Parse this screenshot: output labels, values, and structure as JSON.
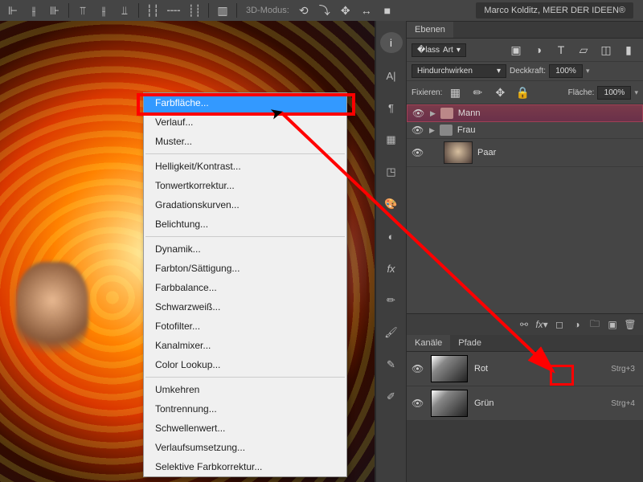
{
  "toolbar": {
    "mode3d": "3D-Modus:",
    "author": "Marco Kolditz, MEER DER IDEEN®"
  },
  "context_menu": {
    "items_group1": [
      "Farbfläche...",
      "Verlauf...",
      "Muster..."
    ],
    "items_group2": [
      "Helligkeit/Kontrast...",
      "Tonwertkorrektur...",
      "Gradationskurven...",
      "Belichtung..."
    ],
    "items_group3": [
      "Dynamik...",
      "Farbton/Sättigung...",
      "Farbbalance...",
      "Schwarzweiß...",
      "Fotofilter...",
      "Kanalmixer...",
      "Color Lookup..."
    ],
    "items_group4": [
      "Umkehren",
      "Tontrennung...",
      "Schwellenwert...",
      "Verlaufsumsetzung...",
      "Selektive Farbkorrektur..."
    ]
  },
  "layers_panel": {
    "title": "Ebenen",
    "filter_label": "Art",
    "blend": "Hindurchwirken",
    "opacity_label": "Deckkraft:",
    "opacity_value": "100%",
    "lock_label": "Fixieren:",
    "fill_label": "Fläche:",
    "fill_value": "100%",
    "layer1": "Mann",
    "layer2": "Frau",
    "layer3": "Paar"
  },
  "channels_panel": {
    "tab_channels": "Kanäle",
    "tab_paths": "Pfade",
    "row1_name": "Rot",
    "row1_key": "Strg+3",
    "row2_name": "Grün",
    "row2_key": "Strg+4"
  }
}
